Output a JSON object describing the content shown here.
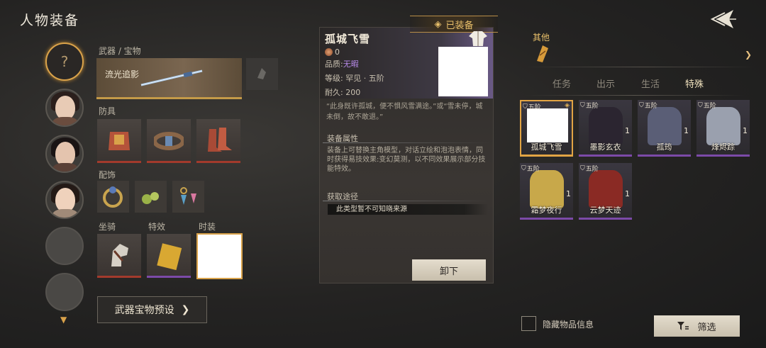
{
  "header": {
    "title": "人物装备"
  },
  "characters": [
    {
      "id": "unknown",
      "placeholder": "?"
    },
    {
      "id": "char2"
    },
    {
      "id": "char3"
    },
    {
      "id": "char4"
    },
    {
      "id": "empty1"
    },
    {
      "id": "empty2"
    }
  ],
  "equipment": {
    "weapon_section": "武器 / 宝物",
    "weapon_name": "流光追影",
    "armor_section": "防具",
    "accessory_section": "配饰",
    "mount_section": "坐骑",
    "effect_section": "特效",
    "fashion_section": "时装",
    "preset_label": "武器宝物预设"
  },
  "tooltip": {
    "equipped_badge": "已装备",
    "name": "孤城飞雪",
    "count": "0",
    "quality_label": "品质:",
    "quality_value": "无暇",
    "grade": "等级: 罕见 · 五阶",
    "durability": "耐久: 200",
    "quote": "“此身既许孤城，便不惧风雪满途。”或“雪未停，城未倒，故不敢退。”",
    "attr_title": "装备属性",
    "attr_text": "装备上可替换主角模型，对话立绘和泡泡表情，同时获得易技效果:变幻莫测，以不同效果展示部分技能特效。",
    "source_title": "获取途径",
    "source_text": "此类型暂不可知晓来源",
    "unequip_label": "卸下"
  },
  "right_panel": {
    "category_label": "其他",
    "tabs": [
      {
        "label": "任务",
        "active": false
      },
      {
        "label": "出示",
        "active": false
      },
      {
        "label": "生活",
        "active": false
      },
      {
        "label": "特殊",
        "active": true
      }
    ],
    "items": [
      {
        "tier": "五阶",
        "name": "孤城飞雪",
        "count": "",
        "selected": true,
        "color": "#ffffff"
      },
      {
        "tier": "五阶",
        "name": "墨影玄衣",
        "count": "1",
        "selected": false,
        "color": "#2b2530"
      },
      {
        "tier": "五阶",
        "name": "孤筠",
        "count": "1",
        "selected": false,
        "color": "#5a5e76"
      },
      {
        "tier": "五阶",
        "name": "烽烬踪",
        "count": "1",
        "selected": false,
        "color": "#9aa0ae"
      },
      {
        "tier": "五阶",
        "name": "霜梦夜行",
        "count": "1",
        "selected": false,
        "color": "#c8a84a"
      },
      {
        "tier": "五阶",
        "name": "云梦天迹",
        "count": "1",
        "selected": false,
        "color": "#8a2a24"
      }
    ],
    "hide_info_label": "隐藏物品信息",
    "filter_label": "筛选"
  },
  "colors": {
    "accent": "#d9a24a",
    "purple_rarity": "#7c4aa8",
    "red_rarity": "#a23a2c"
  }
}
